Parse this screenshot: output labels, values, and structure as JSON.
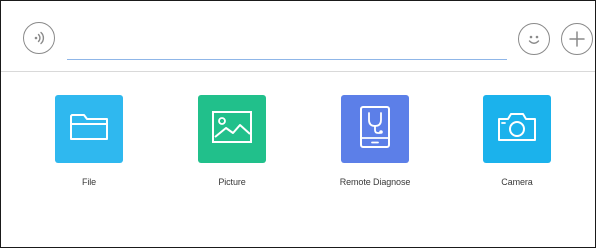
{
  "input": {
    "value": "",
    "placeholder": ""
  },
  "attachments": [
    {
      "id": "file",
      "label": "File",
      "icon": "folder-icon",
      "color": "#2fb8ef"
    },
    {
      "id": "picture",
      "label": "Picture",
      "icon": "image-icon",
      "color": "#21c08b"
    },
    {
      "id": "remote",
      "label": "Remote Diagnose",
      "icon": "stethoscope-tablet-icon",
      "color": "#5c7fe8"
    },
    {
      "id": "camera",
      "label": "Camera",
      "icon": "camera-icon",
      "color": "#1bb2ec"
    }
  ],
  "colors": {
    "accent_underline": "#8fb6e8",
    "border": "#1a1a1a"
  }
}
